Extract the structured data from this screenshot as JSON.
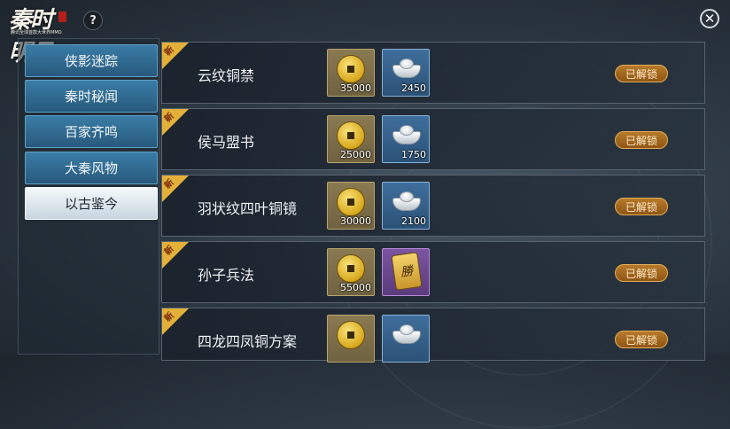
{
  "header": {
    "logo_title": "秦时明月",
    "logo_subtitle": "腾讯全球首款大世界MMO",
    "help_label": "?",
    "close_label": "✕"
  },
  "sidebar": {
    "tabs": [
      {
        "label": "侠影迷踪",
        "active": false
      },
      {
        "label": "秦时秘闻",
        "active": false
      },
      {
        "label": "百家齐鸣",
        "active": false
      },
      {
        "label": "大秦风物",
        "active": false
      },
      {
        "label": "以古鉴今",
        "active": true
      }
    ]
  },
  "items": [
    {
      "new": "新",
      "name": "云纹铜禁",
      "cost1": {
        "icon": "copper-coin-icon",
        "qty": "35000"
      },
      "cost2": {
        "icon": "silver-ingot-icon",
        "qty": "2450"
      },
      "status": "已解锁"
    },
    {
      "new": "新",
      "name": "侯马盟书",
      "cost1": {
        "icon": "copper-coin-icon",
        "qty": "25000"
      },
      "cost2": {
        "icon": "silver-ingot-icon",
        "qty": "1750"
      },
      "status": "已解锁"
    },
    {
      "new": "新",
      "name": "羽状纹四叶铜镜",
      "cost1": {
        "icon": "copper-coin-icon",
        "qty": "30000"
      },
      "cost2": {
        "icon": "silver-ingot-icon",
        "qty": "2100"
      },
      "status": "已解锁"
    },
    {
      "new": "新",
      "name": "孙子兵法",
      "cost1": {
        "icon": "copper-coin-icon",
        "qty": "55000"
      },
      "cost2": {
        "icon": "token-icon",
        "glyph": "勝",
        "qty": ""
      },
      "status": "已解锁"
    },
    {
      "new": "新",
      "name": "四龙四凤铜方案",
      "cost1": {
        "icon": "copper-coin-icon",
        "qty": ""
      },
      "cost2": {
        "icon": "silver-ingot-icon",
        "qty": ""
      },
      "status": "已解锁"
    }
  ],
  "colors": {
    "accent_gold": "#e3b13a",
    "tab_blue": "#3a7da6",
    "unlock_orange": "#b77a2a"
  }
}
